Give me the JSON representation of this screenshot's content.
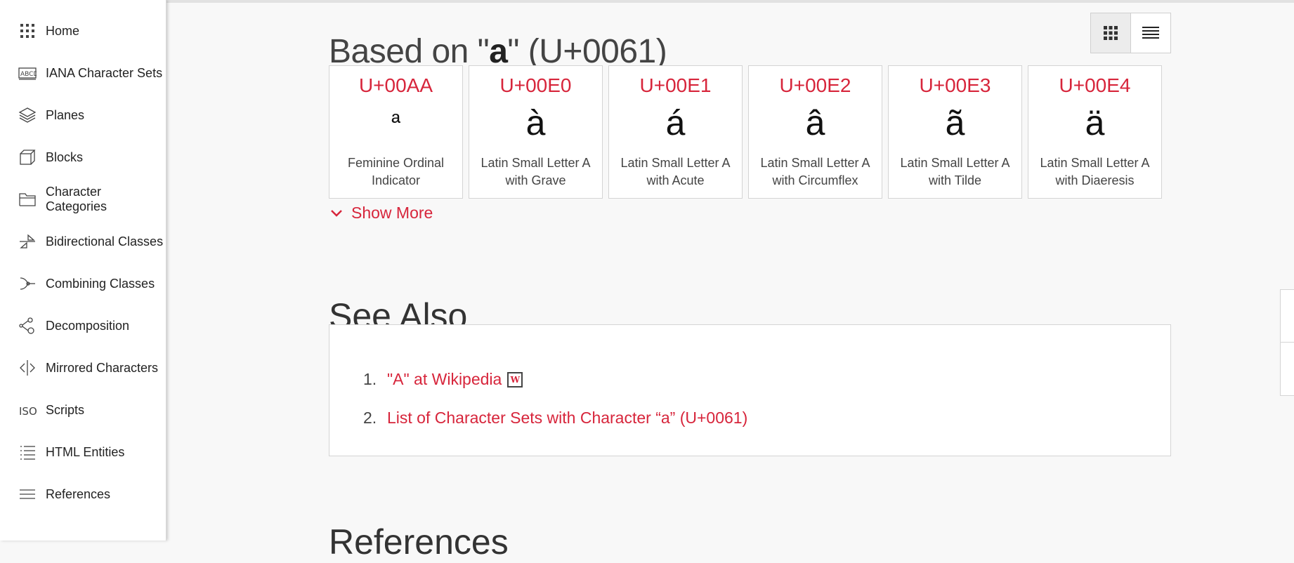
{
  "sidebar": {
    "items": [
      {
        "label": "Home",
        "icon": "grid-icon"
      },
      {
        "label": "IANA Character Sets",
        "icon": "abcd-icon"
      },
      {
        "label": "Planes",
        "icon": "layers-icon"
      },
      {
        "label": "Blocks",
        "icon": "cube-icon"
      },
      {
        "label": "Character Categories",
        "icon": "folder-icon"
      },
      {
        "label": "Bidirectional Classes",
        "icon": "bidi-icon"
      },
      {
        "label": "Combining Classes",
        "icon": "combine-icon"
      },
      {
        "label": "Decomposition",
        "icon": "decompose-icon"
      },
      {
        "label": "Mirrored Characters",
        "icon": "mirror-icon"
      },
      {
        "label": "Scripts",
        "icon": "iso-icon"
      },
      {
        "label": "HTML Entities",
        "icon": "list-icon"
      },
      {
        "label": "References",
        "icon": "menu-icon"
      }
    ]
  },
  "main": {
    "based_prefix": "Based on \"",
    "based_glyph": "a",
    "based_suffix": "\" (U+0061)",
    "view_toggle": {
      "grid_label": "grid view",
      "list_label": "list view",
      "active": "grid"
    },
    "cards": [
      {
        "code": "U+00AA",
        "char": "ª",
        "name_line1": "Feminine Ordinal",
        "name_line2": "Indicator"
      },
      {
        "code": "U+00E0",
        "char": "à",
        "name_line1": "Latin Small Letter A",
        "name_line2": "with Grave"
      },
      {
        "code": "U+00E1",
        "char": "á",
        "name_line1": "Latin Small Letter A",
        "name_line2": "with Acute"
      },
      {
        "code": "U+00E2",
        "char": "â",
        "name_line1": "Latin Small Letter A",
        "name_line2": "with Circumflex"
      },
      {
        "code": "U+00E3",
        "char": "ã",
        "name_line1": "Latin Small Letter A",
        "name_line2": "with Tilde"
      },
      {
        "code": "U+00E4",
        "char": "ä",
        "name_line1": "Latin Small Letter A",
        "name_line2": "with Diaeresis"
      }
    ],
    "show_more": "Show More",
    "see_also": {
      "title": "See Also",
      "items": [
        {
          "num": "1.",
          "label": "\"A\" at Wikipedia",
          "wiki_icon": "W"
        },
        {
          "num": "2.",
          "label": "List of Character Sets with Character “a” (U+0061)"
        }
      ]
    },
    "references_title": "References"
  },
  "colors": {
    "accent": "#d7253b",
    "sidebar_bg": "#ffffff",
    "page_bg": "#f8f8f8"
  }
}
